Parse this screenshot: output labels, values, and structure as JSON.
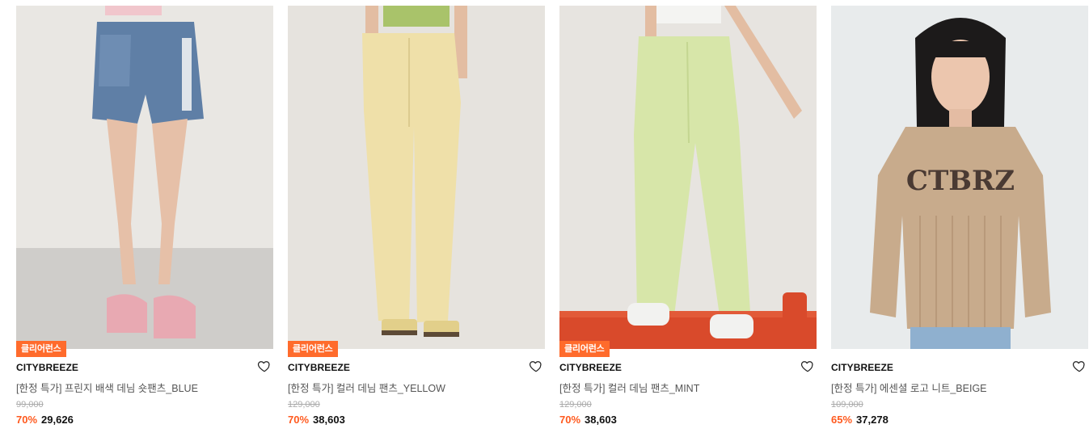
{
  "products": [
    {
      "badge": "클리어런스",
      "brand": "CITYBREEZE",
      "name": "[한정 특가] 프린지 배색 데님 숏팬츠_BLUE",
      "original_price": "99,000",
      "discount": "70%",
      "sale_price": "29,626",
      "wishlisted": false
    },
    {
      "badge": "클리어런스",
      "brand": "CITYBREEZE",
      "name": "[한정 특가] 컬러 데님 팬츠_YELLOW",
      "original_price": "129,000",
      "discount": "70%",
      "sale_price": "38,603",
      "wishlisted": false
    },
    {
      "badge": "클리어런스",
      "brand": "CITYBREEZE",
      "name": "[한정 특가] 컬러 데님 팬츠_MINT",
      "original_price": "129,000",
      "discount": "70%",
      "sale_price": "38,603",
      "wishlisted": false
    },
    {
      "badge": "",
      "brand": "CITYBREEZE",
      "name": "[한정 특가] 에센셜 로고 니트_BEIGE",
      "original_price": "109,000",
      "discount": "65%",
      "sale_price": "37,278",
      "wishlisted": false,
      "print_text": "CTBRZ"
    }
  ],
  "colors": {
    "accent": "#ff5a1f",
    "badge_bg": "#ff6b2c"
  }
}
